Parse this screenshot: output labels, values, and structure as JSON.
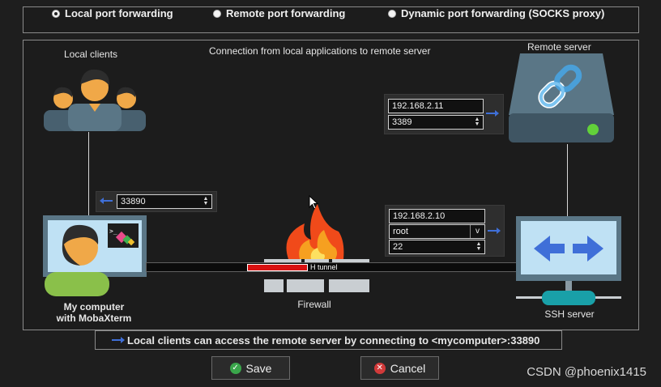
{
  "modes": [
    {
      "label": "Local port forwarding",
      "selected": true
    },
    {
      "label": "Remote port forwarding",
      "selected": false
    },
    {
      "label": "Dynamic port forwarding (SOCKS proxy)",
      "selected": false
    }
  ],
  "diagram": {
    "local_clients_label": "Local clients",
    "connection_label": "Connection from local applications to remote server",
    "remote_server_label": "Remote server",
    "my_computer_label_line1": "My computer",
    "my_computer_label_line2": "with MobaXterm",
    "firewall_label": "Firewall",
    "ssh_server_label": "SSH server",
    "tunnel_label": "H tunnel"
  },
  "forwarded_port": {
    "value": "33890"
  },
  "remote_server": {
    "host": "192.168.2.11",
    "port": "3389"
  },
  "ssh_server": {
    "host": "192.168.2.10",
    "user": "root",
    "port": "22"
  },
  "status_text": "Local clients can access the remote server by connecting to <mycomputer>:33890",
  "buttons": {
    "save": "Save",
    "cancel": "Cancel"
  },
  "watermark": "CSDN @phoenix1415",
  "colors": {
    "accent_arrow": "#3f6fd8",
    "save_icon": "#3aa64b",
    "cancel_icon": "#d23a3a",
    "tunnel_progress": "#d81111"
  }
}
